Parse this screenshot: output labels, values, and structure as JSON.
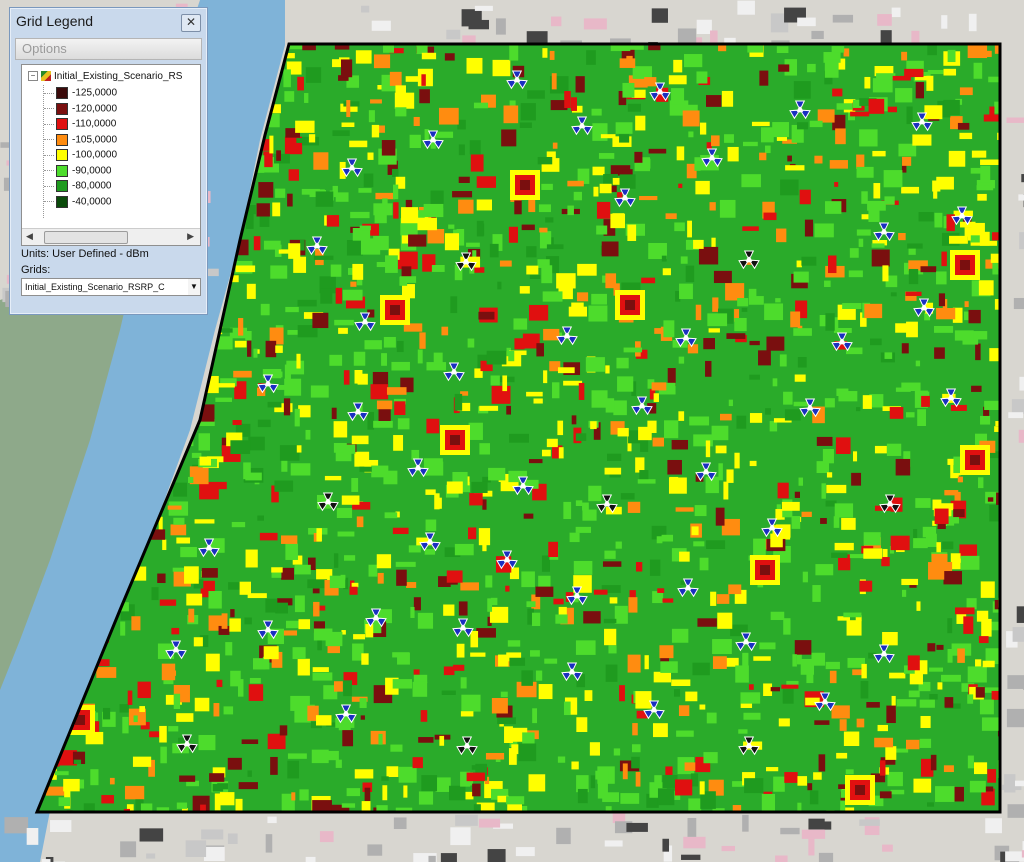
{
  "legend": {
    "title": "Grid Legend",
    "options_label": "Options",
    "layer_name": "Initial_Existing_Scenario_RS",
    "units": "Units: User Defined - dBm",
    "grids_label": "Grids:",
    "grid_value": "Initial_Existing_Scenario_RSRP_C",
    "items": [
      {
        "label": "-125,0000",
        "color": "#3b0a0a"
      },
      {
        "label": "-120,0000",
        "color": "#7a0f0f"
      },
      {
        "label": "-110,0000",
        "color": "#e01010"
      },
      {
        "label": "-105,0000",
        "color": "#ff8c10"
      },
      {
        "label": "-100,0000",
        "color": "#ffff00"
      },
      {
        "label": "-90,0000",
        "color": "#4ddc2c"
      },
      {
        "label": "-80,0000",
        "color": "#1f9b1f"
      },
      {
        "label": "-40,0000",
        "color": "#0a4a0a"
      }
    ]
  },
  "icons": {
    "close": "close-icon",
    "site_blue": "antenna-site-icon",
    "site_black": "antenna-site-icon"
  },
  "colors": {
    "river": "#7fb3d8",
    "coverage_base": "#2aab2a",
    "boundary": "#000000",
    "site_blue": "#1a2fc0",
    "site_black": "#111111"
  }
}
